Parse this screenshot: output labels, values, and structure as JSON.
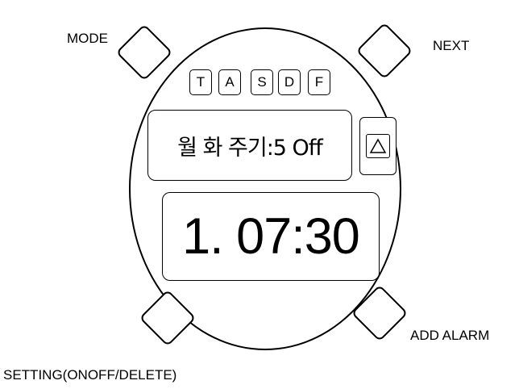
{
  "labels": {
    "mode": "MODE",
    "next": "NEXT",
    "add_alarm": "ADD ALARM",
    "setting": "SETTING(ONOFF/DELETE)"
  },
  "keys": [
    "T",
    "A",
    "S",
    "D",
    "F"
  ],
  "display": {
    "info": "월 화 주기:5 Off",
    "time": "1. 07:30"
  },
  "icons": {
    "up_button": "up-triangle-icon"
  }
}
